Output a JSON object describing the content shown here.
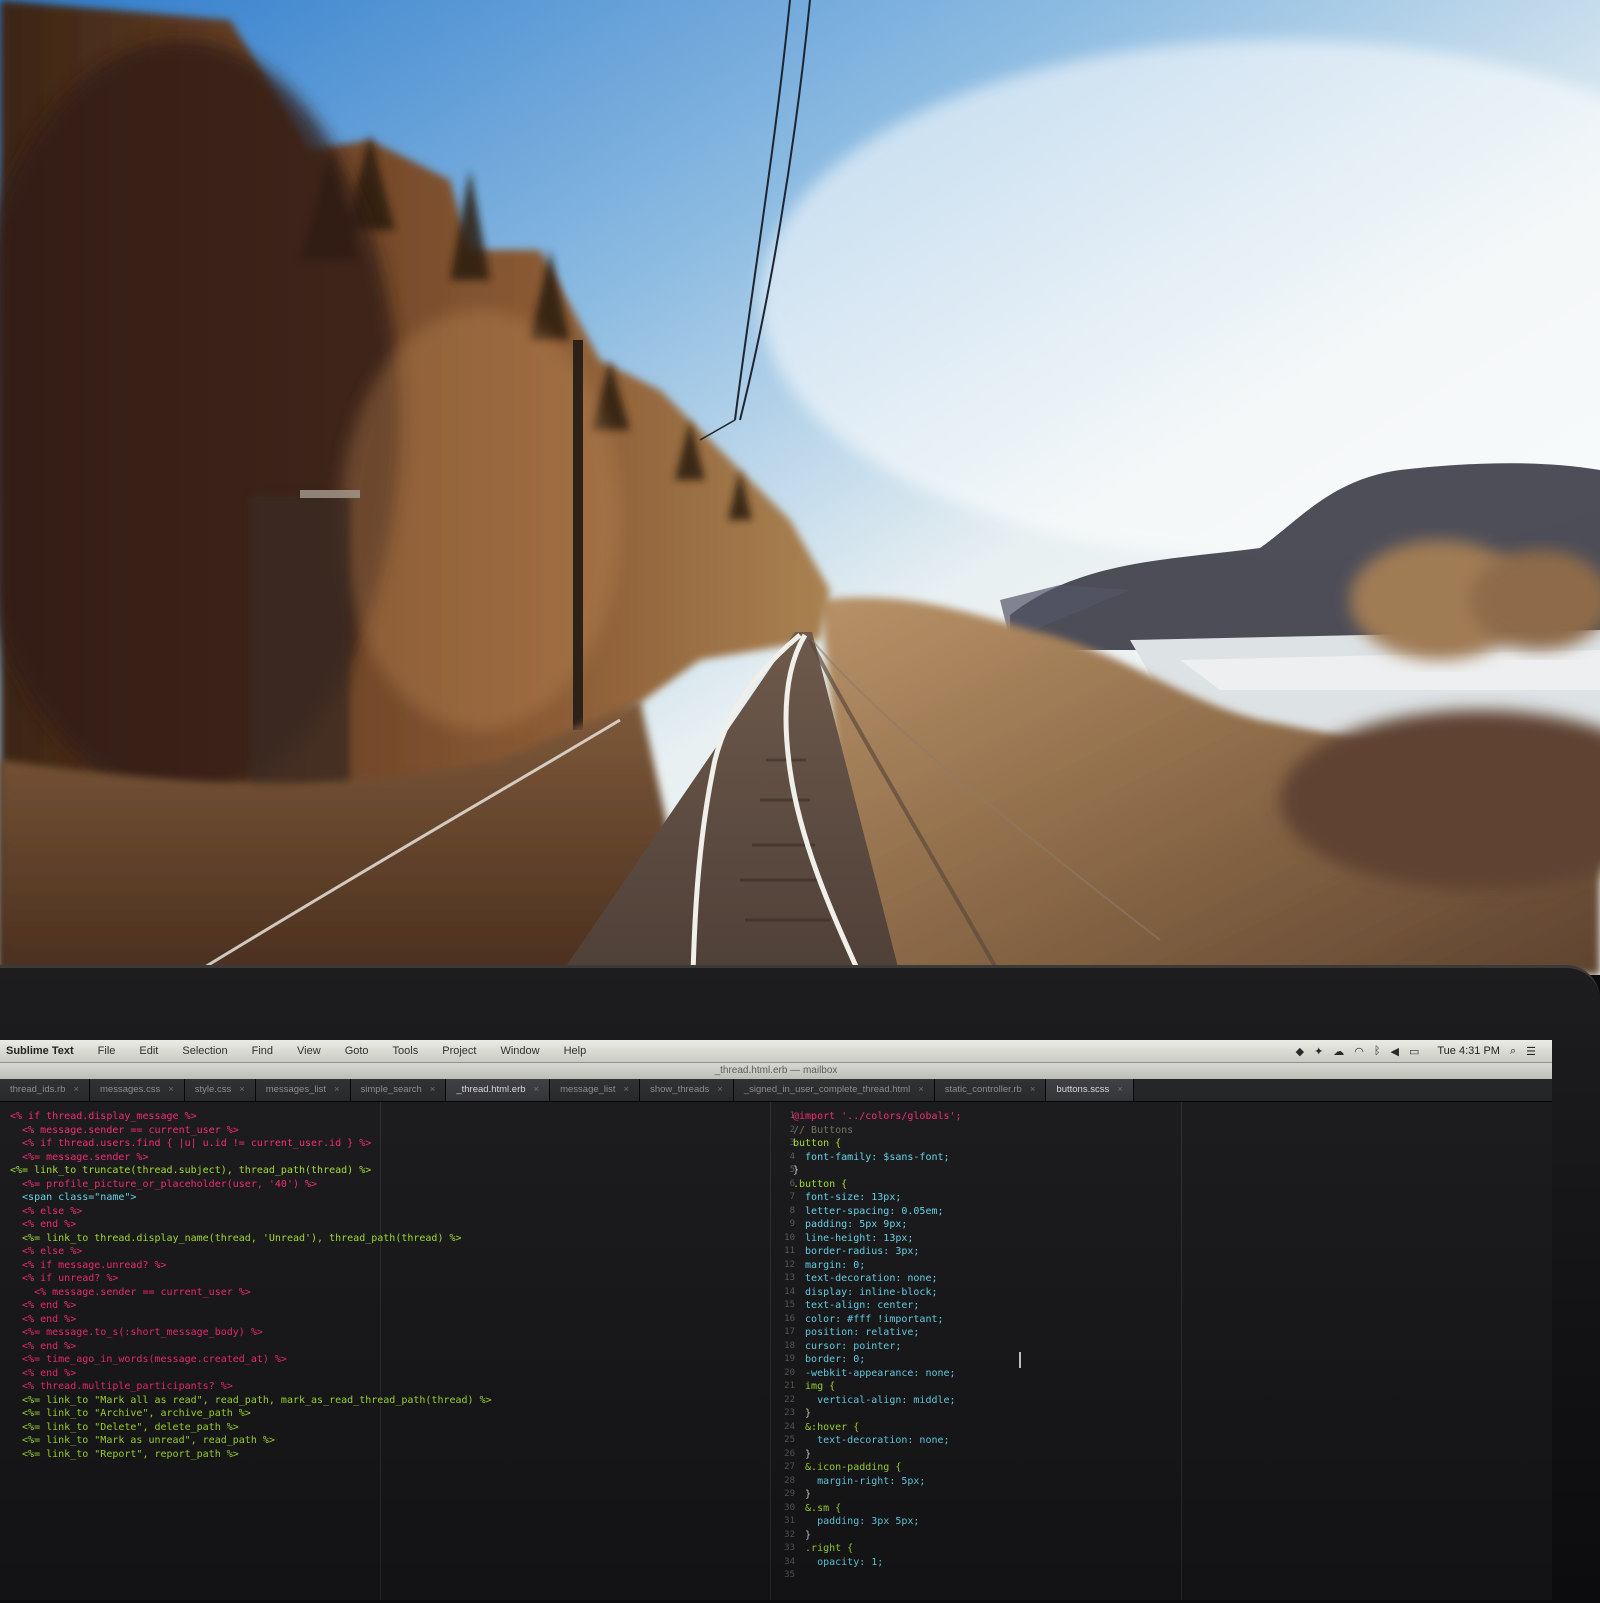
{
  "menubar": {
    "app_name": "Sublime Text",
    "menus": [
      "File",
      "Edit",
      "Selection",
      "Find",
      "View",
      "Goto",
      "Tools",
      "Project",
      "Window",
      "Help"
    ],
    "clock": "Tue 4:31 PM"
  },
  "window": {
    "title": "_thread.html.erb — mailbox"
  },
  "tabs": [
    {
      "label": "thread_ids.rb"
    },
    {
      "label": "messages.css"
    },
    {
      "label": "style.css"
    },
    {
      "label": "messages_list"
    },
    {
      "label": "simple_search"
    },
    {
      "label": "_thread.html.erb",
      "active": true
    },
    {
      "label": "message_list"
    },
    {
      "label": "show_threads"
    },
    {
      "label": "_signed_in_user_complete_thread.html"
    },
    {
      "label": "static_controller.rb"
    },
    {
      "label": "buttons.scss",
      "selected": true
    }
  ],
  "left_code": [
    "<% if thread.display_message %>",
    "  <% message.sender == current_user %>",
    "  <% if thread.users.find { |u| u.id != current_user.id } %>",
    "",
    "  <%= message.sender %>",
    "",
    "",
    "<%= link_to truncate(thread.subject), thread_path(thread) %>",
    "",
    "  <%= profile_picture_or_placeholder(user, '40') %>",
    "",
    "  <span class=\"name\">",
    "  <% else %>",
    "  <% end %>",
    "  <%= link_to thread.display_name(thread, 'Unread'), thread_path(thread) %>",
    "  <% else %>",
    "  <% if message.unread? %>",
    "  <% if unread? %>",
    "    <% message.sender == current_user %>",
    "  <% end %>",
    "  <% end %>",
    "  <%= message.to_s(:short_message_body) %>",
    "  <% end %>",
    "  <%= time_ago_in_words(message.created_at) %>",
    "  <% end %>",
    "",
    "  <% thread.multiple_participants? %>",
    "  <%= link_to \"Mark all as read\", read_path, mark_as_read_thread_path(thread) %>",
    "  <%= link_to \"Archive\", archive_path %>",
    "  <%= link_to \"Delete\", delete_path %>",
    "",
    "  <%= link_to \"Mark as unread\", read_path %>",
    "  <%= link_to \"Report\", report_path %>"
  ],
  "right_code": [
    "@import '../colors/globals';",
    "// Buttons",
    "button {",
    "  font-family: $sans-font;",
    "}",
    ".button {",
    "  font-size: 13px;",
    "  letter-spacing: 0.05em;",
    "  padding: 5px 9px;",
    "  line-height: 13px;",
    "  border-radius: 3px;",
    "  margin: 0;",
    "  text-decoration: none;",
    "  display: inline-block;",
    "  text-align: center;",
    "  color: #fff !important;",
    "  position: relative;",
    "  cursor: pointer;",
    "  border: 0;",
    "  -webkit-appearance: none;",
    "",
    "  img {",
    "    vertical-align: middle;",
    "  }",
    "  &:hover {",
    "    text-decoration: none;",
    "  }",
    "  &.icon-padding {",
    "    margin-right: 5px;",
    "  }",
    "  &.sm {",
    "    padding: 3px 5px;",
    "  }",
    "  .right {",
    "    opacity: 1;"
  ],
  "colors": {
    "sky_top": "#3f87c9",
    "sky_bottom": "#f2f5f1",
    "forest": "#5a3b22",
    "editor_bg": "#161618"
  }
}
